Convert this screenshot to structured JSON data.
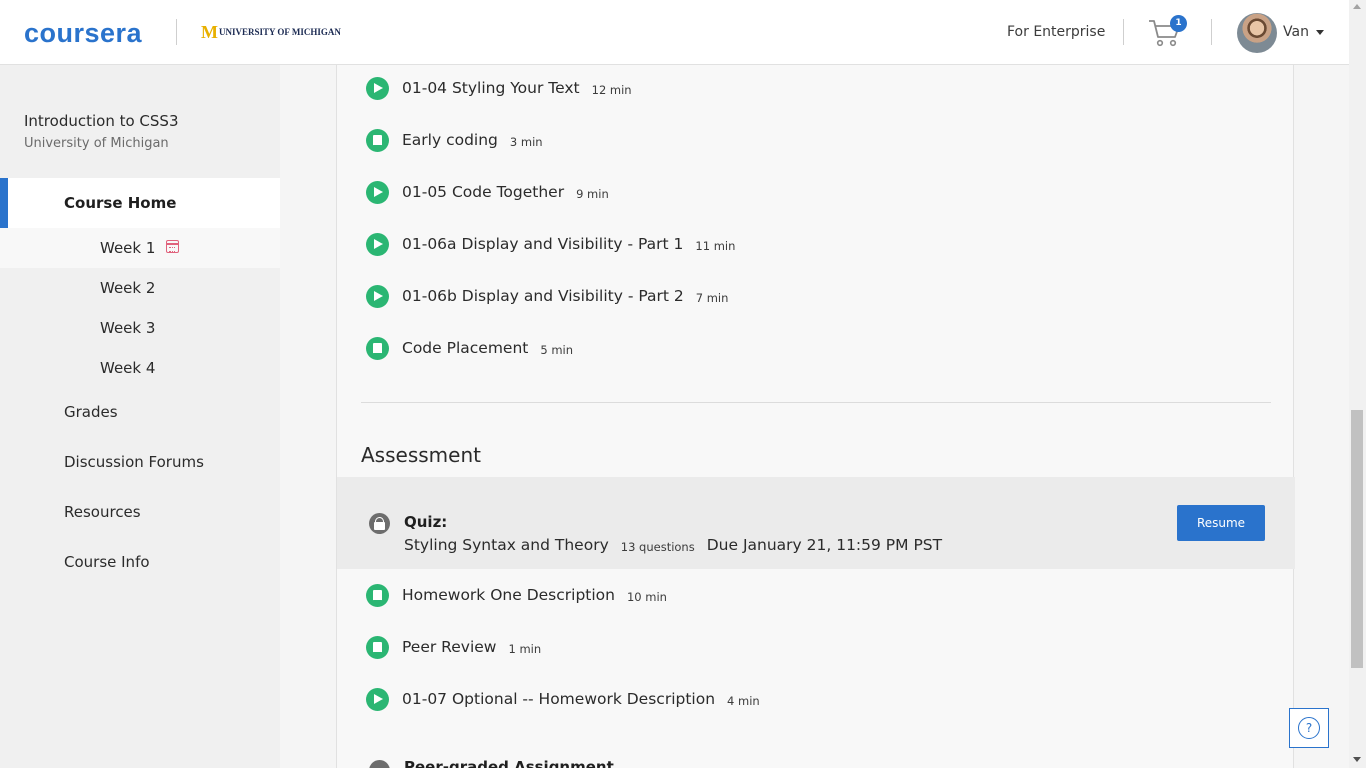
{
  "header": {
    "logo": "coursera",
    "partner": {
      "mark": "M",
      "name": "UNIVERSITY OF MICHIGAN"
    },
    "enterprise_link": "For Enterprise",
    "cart_count": "1",
    "user_name": "Van"
  },
  "sidebar": {
    "course_title": "Introduction to CSS3",
    "course_university": "University of Michigan",
    "home_label": "Course Home",
    "weeks": [
      {
        "label": "Week 1"
      },
      {
        "label": "Week 2"
      },
      {
        "label": "Week 3"
      },
      {
        "label": "Week 4"
      }
    ],
    "nav": [
      {
        "label": "Grades"
      },
      {
        "label": "Discussion Forums"
      },
      {
        "label": "Resources"
      },
      {
        "label": "Course Info"
      }
    ]
  },
  "main": {
    "lessons": [
      {
        "type": "video",
        "title": "01-04 Styling Your Text",
        "duration": "12 min"
      },
      {
        "type": "reading",
        "title": "Early coding",
        "duration": "3 min"
      },
      {
        "type": "video",
        "title": "01-05 Code Together",
        "duration": "9 min"
      },
      {
        "type": "video",
        "title": "01-06a Display and Visibility - Part 1",
        "duration": "11 min"
      },
      {
        "type": "video",
        "title": "01-06b Display and Visibility - Part 2",
        "duration": "7 min"
      },
      {
        "type": "reading",
        "title": "Code Placement",
        "duration": "5 min"
      }
    ],
    "assessment_heading": "Assessment",
    "quiz": {
      "kind": "Quiz:",
      "title": "Styling Syntax and Theory",
      "questions": "13 questions",
      "due": "Due January 21, 11:59 PM PST",
      "button": "Resume"
    },
    "assessment_items": [
      {
        "type": "reading",
        "title": "Homework One Description",
        "duration": "10 min"
      },
      {
        "type": "reading",
        "title": "Peer Review",
        "duration": "1 min"
      },
      {
        "type": "video",
        "title": "01-07 Optional -- Homework Description",
        "duration": "4 min"
      }
    ],
    "partial_next": "Peer-graded Assignment"
  },
  "help": {
    "glyph": "?"
  },
  "colors": {
    "brand_blue": "#2a73cc",
    "complete_green": "#2bb673",
    "calendar_pink": "#e0627c",
    "michigan_maize": "#e8b000"
  }
}
